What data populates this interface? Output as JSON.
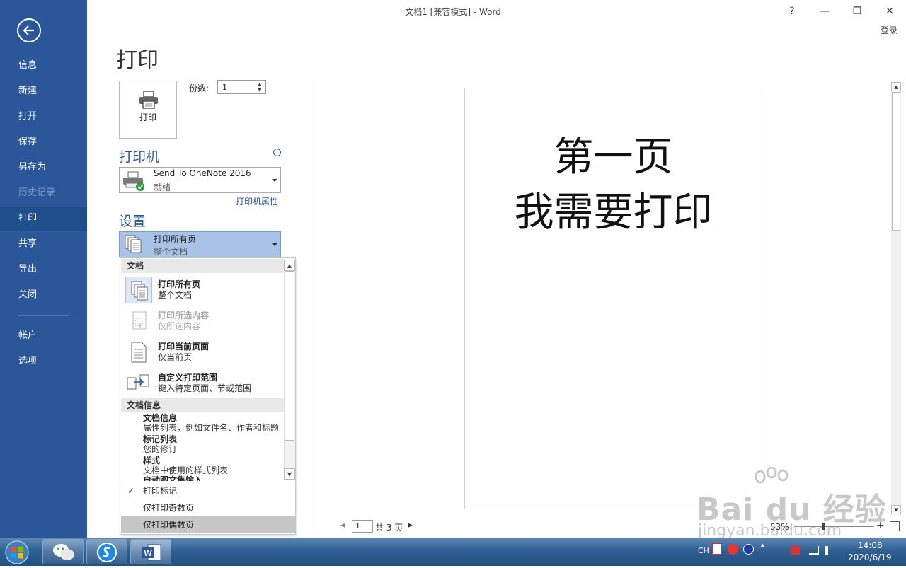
{
  "window": {
    "title": "文档1 [兼容模式] - Word",
    "help": "?",
    "minimize": "—",
    "restore": "❐",
    "close": "✕",
    "login": "登录"
  },
  "sidebar": {
    "items": [
      {
        "label": "信息"
      },
      {
        "label": "新建"
      },
      {
        "label": "打开"
      },
      {
        "label": "保存"
      },
      {
        "label": "另存为"
      },
      {
        "label": "历史记录"
      },
      {
        "label": "打印"
      },
      {
        "label": "共享"
      },
      {
        "label": "导出"
      },
      {
        "label": "关闭"
      },
      {
        "label": "帐户"
      },
      {
        "label": "选项"
      }
    ],
    "disabled_item": "历史记录",
    "active_item": "打印"
  },
  "print": {
    "heading": "打印",
    "button_label": "打印",
    "copies_label": "份数:",
    "copies_value": "1"
  },
  "printer": {
    "section_title": "打印机",
    "info_icon": "i",
    "name": "Send To OneNote 2016",
    "status": "就绪",
    "properties_link": "打印机属性"
  },
  "settings": {
    "section_title": "设置",
    "selected_title": "打印所有页",
    "selected_sub": "整个文档"
  },
  "dropdown": {
    "group_document": "文档",
    "options": [
      {
        "title": "打印所有页",
        "sub": "整个文档"
      },
      {
        "title": "打印所选内容",
        "sub": "仅所选内容"
      },
      {
        "title": "打印当前页面",
        "sub": "仅当前页"
      },
      {
        "title": "自定义打印范围",
        "sub": "键入特定页面、节或范围"
      }
    ],
    "group_info": "文档信息",
    "info_items": [
      {
        "title": "文档信息",
        "sub": "属性列表，例如文件名、作者和标题"
      },
      {
        "title": "标记列表",
        "sub": "您的修订"
      },
      {
        "title": "样式",
        "sub": "文档中使用的样式列表"
      },
      {
        "title": "自动图文集输入",
        "sub": ""
      }
    ],
    "checks": [
      {
        "label": "打印标记",
        "checked": true
      },
      {
        "label": "仅打印奇数页",
        "checked": false
      },
      {
        "label": "仅打印偶数页",
        "checked": false
      }
    ],
    "check_mark": "✓"
  },
  "preview": {
    "line1": "第一页",
    "line2": "我需要打印"
  },
  "pager": {
    "prev": "◀",
    "current": "1",
    "total": "共 3 页",
    "next": "▶"
  },
  "zoom": {
    "level": "53%",
    "minus": "—",
    "plus": "+",
    "level_fraction": 0.53
  },
  "watermark": {
    "brand": "Bai du 经验",
    "url": "jingyan.baidu.com"
  },
  "taskbar": {
    "ime": "CH",
    "time": "14:08",
    "date": "2020/6/19",
    "apps": [
      "wechat-icon",
      "sogou-browser-icon",
      "word-icon"
    ]
  },
  "colors": {
    "accent": "#2b579a",
    "selected_bg": "#a9c3e8",
    "highlight_bg": "#c6c6c6"
  }
}
